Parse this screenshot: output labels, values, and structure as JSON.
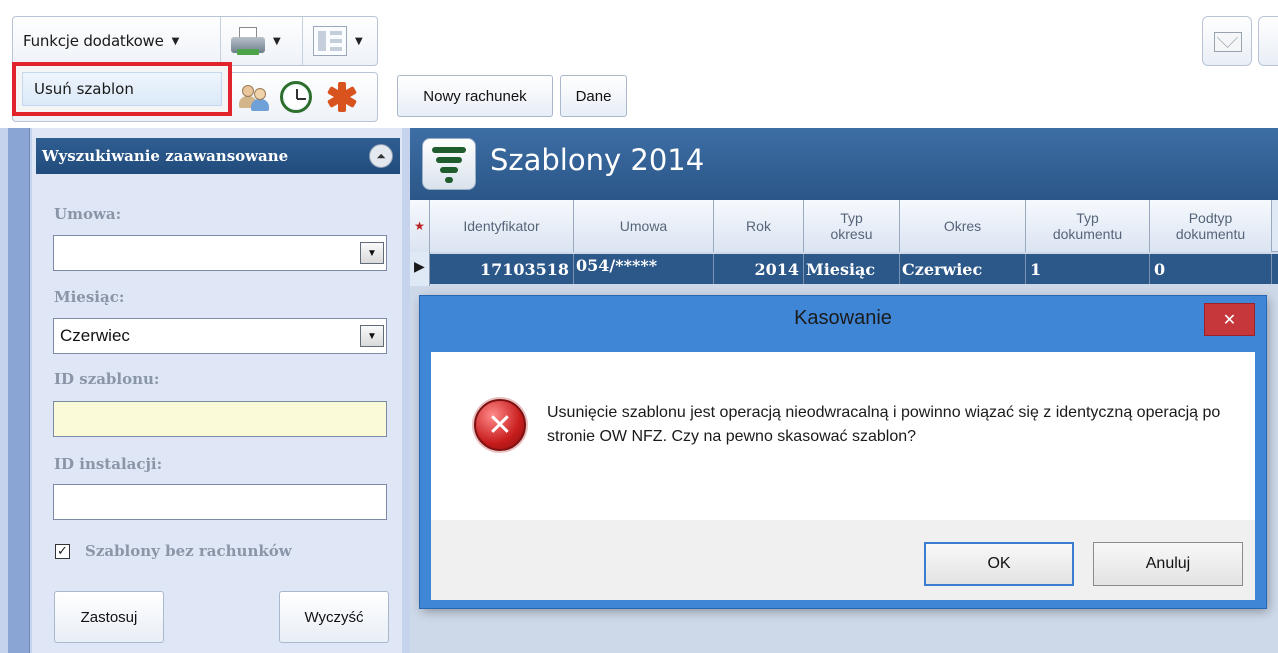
{
  "toolbar": {
    "funkcje_label": "Funkcje dodatkowe",
    "nowy_rachunek": "Nowy rachunek",
    "dane": "Dane"
  },
  "popup": {
    "usun_szablon": "Usuń szablon"
  },
  "left_panel": {
    "header": "Wyszukiwanie zaawansowane",
    "umowa_label": "Umowa:",
    "umowa_value": "",
    "miesiac_label": "Miesiąc:",
    "miesiac_value": "Czerwiec",
    "id_szablonu_label": "ID szablonu:",
    "id_instalacji_label": "ID instalacji:",
    "checkbox_label": "Szablony bez rachunków",
    "checkbox_checked": true,
    "zastosuj": "Zastosuj",
    "wyczysc": "Wyczyść"
  },
  "grid": {
    "title": "Szablony 2014",
    "columns": [
      {
        "line1": "Identyfikator",
        "line2": ""
      },
      {
        "line1": "Umowa",
        "line2": ""
      },
      {
        "line1": "Rok",
        "line2": ""
      },
      {
        "line1": "Typ",
        "line2": "okresu"
      },
      {
        "line1": "Okres",
        "line2": ""
      },
      {
        "line1": "Typ",
        "line2": "dokumentu"
      },
      {
        "line1": "Podtyp",
        "line2": "dokumentu"
      }
    ],
    "row": {
      "identyfikator": "17103518",
      "umowa": "054/*****",
      "rok": "2014",
      "typ_okresu": "Miesiąc",
      "okres": "Czerwiec",
      "typ_dokumentu": "1",
      "podtyp_dokumentu": "0"
    }
  },
  "dialog": {
    "title": "Kasowanie",
    "message": "Usunięcie szablonu jest operacją nieodwracalną i powinno wiązać się z identyczną operacją po stronie OW NFZ. Czy na pewno skasować szablon?",
    "ok": "OK",
    "anuluj": "Anuluj"
  },
  "colors": {
    "header_blue": "#2b5688",
    "dialog_frame": "#3f86d6",
    "highlight_red": "#e1242c",
    "close_red": "#c6373c"
  }
}
